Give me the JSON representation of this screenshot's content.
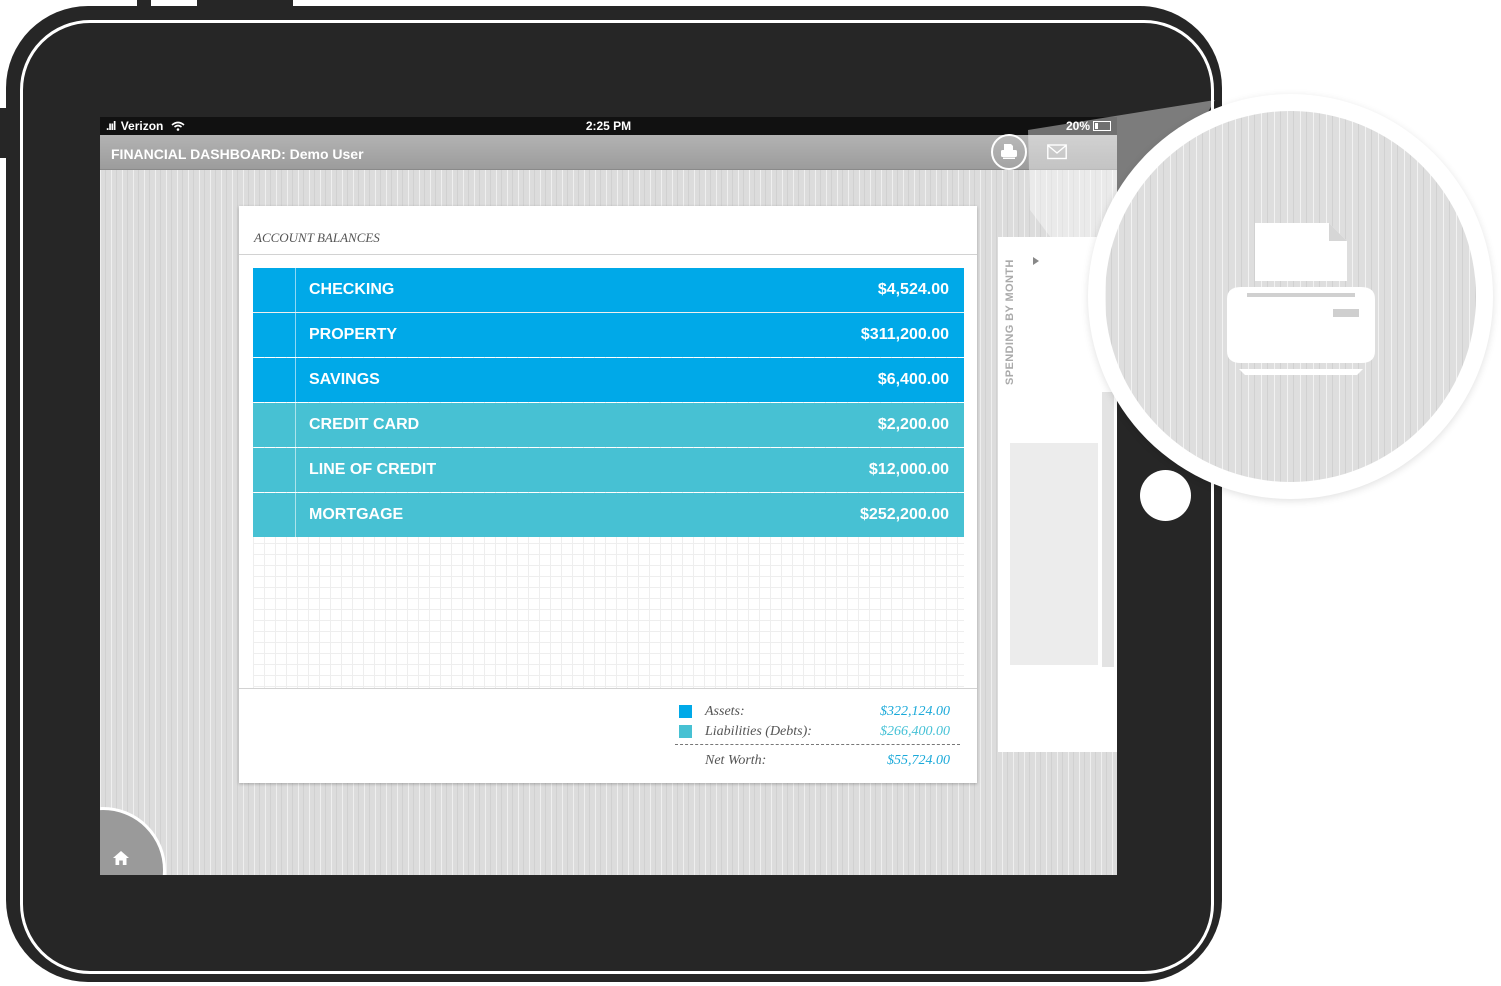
{
  "status_bar": {
    "signal": ".ııl",
    "carrier": "Verizon",
    "time": "2:25 PM",
    "battery": "20%"
  },
  "header": {
    "title": "FINANCIAL DASHBOARD: Demo User",
    "print_icon": "printer-icon",
    "mail_icon": "envelope-icon"
  },
  "account_balances": {
    "title": "ACCOUNT BALANCES",
    "rows": [
      {
        "label": "CHECKING",
        "amount": "$4,524.00",
        "type": "asset"
      },
      {
        "label": "PROPERTY",
        "amount": "$311,200.00",
        "type": "asset"
      },
      {
        "label": "SAVINGS",
        "amount": "$6,400.00",
        "type": "asset"
      },
      {
        "label": "CREDIT CARD",
        "amount": "$2,200.00",
        "type": "liability"
      },
      {
        "label": "LINE OF CREDIT",
        "amount": "$12,000.00",
        "type": "liability"
      },
      {
        "label": "MORTGAGE",
        "amount": "$252,200.00",
        "type": "liability"
      }
    ],
    "summary": {
      "assets_label": "Assets:",
      "assets_value": "$322,124.00",
      "liabilities_label": "Liabilities (Debts):",
      "liabilities_value": "$266,400.00",
      "net_worth_label": "Net Worth:",
      "net_worth_value": "$55,724.00"
    }
  },
  "side_panel": {
    "title": "SPENDING BY MONTH"
  },
  "nav": {
    "home_icon": "home-icon"
  },
  "callout": {
    "icon": "printer-icon"
  },
  "colors": {
    "asset": "#00a9e8",
    "liability": "#47c1d3",
    "value_text": "#1aa9d9",
    "value_text_light": "#45c1d6"
  }
}
